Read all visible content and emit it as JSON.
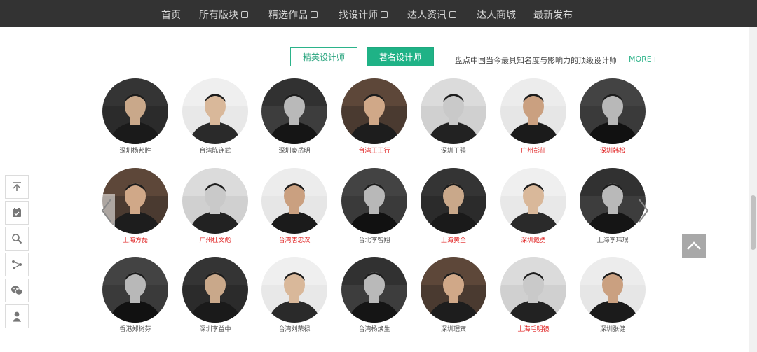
{
  "nav": {
    "items": [
      {
        "label": "首页",
        "has_dropdown": false
      },
      {
        "label": "所有版块",
        "has_dropdown": true
      },
      {
        "label": "精选作品",
        "has_dropdown": true
      },
      {
        "label": "找设计师",
        "has_dropdown": true
      },
      {
        "label": "达人资讯",
        "has_dropdown": true
      },
      {
        "label": "达人商城",
        "has_dropdown": false
      },
      {
        "label": "最新发布",
        "has_dropdown": false
      }
    ]
  },
  "tabs": {
    "elite_label": "精英设计师",
    "famous_label": "著名设计师",
    "active": "famous"
  },
  "tagline": "盘点中国当今最具知名度与影响力的顶级设计师",
  "more_label": "MORE+",
  "colors": {
    "accent": "#1fb286",
    "highlight_name": "#e02020",
    "nav_bg": "#333333"
  },
  "designers": [
    [
      {
        "name": "深圳杨邦胜",
        "highlight": false
      },
      {
        "name": "台湾陈连武",
        "highlight": false
      },
      {
        "name": "深圳秦岳明",
        "highlight": false
      },
      {
        "name": "台湾王正行",
        "highlight": true
      },
      {
        "name": "深圳于强",
        "highlight": false
      },
      {
        "name": "广州彭征",
        "highlight": true
      },
      {
        "name": "深圳韩松",
        "highlight": true
      }
    ],
    [
      {
        "name": "上海方磊",
        "highlight": true
      },
      {
        "name": "广州杜文彪",
        "highlight": true
      },
      {
        "name": "台湾唐忠汉",
        "highlight": true
      },
      {
        "name": "台北李智翔",
        "highlight": false
      },
      {
        "name": "上海黄全",
        "highlight": true
      },
      {
        "name": "深圳戴勇",
        "highlight": true
      },
      {
        "name": "上海李玮珉",
        "highlight": false
      }
    ],
    [
      {
        "name": "香港郑树芬",
        "highlight": false
      },
      {
        "name": "深圳李益中",
        "highlight": false
      },
      {
        "name": "台湾刘荣禄",
        "highlight": false
      },
      {
        "name": "台湾杨焕生",
        "highlight": false
      },
      {
        "name": "深圳琚宾",
        "highlight": false
      },
      {
        "name": "上海毛明镜",
        "highlight": true
      },
      {
        "name": "深圳张健",
        "highlight": false
      }
    ]
  ],
  "side_tools": [
    "top-icon",
    "calendar-icon",
    "search-icon",
    "share-icon",
    "wechat-icon",
    "user-icon"
  ]
}
